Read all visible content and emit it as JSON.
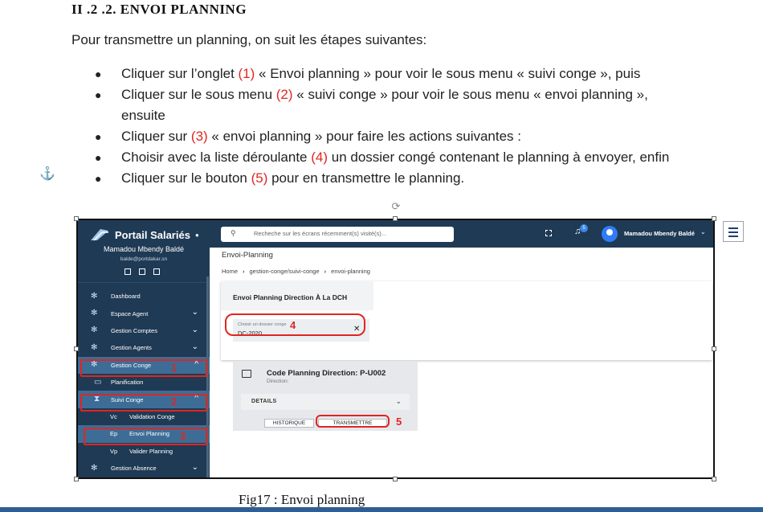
{
  "heading": "II .2 .2.  ENVOI PLANNING",
  "intro": "Pour transmettre un planning, on suit les étapes suivantes:",
  "steps": [
    {
      "pre": "Cliquer sur l’onglet ",
      "num": "(1)",
      "post": " « Envoi planning » pour voir le sous menu « suivi conge », puis"
    },
    {
      "pre": "Cliquer sur le sous menu ",
      "num": "(2)",
      "post": " « suivi conge » pour voir le sous menu « envoi planning », ensuite"
    },
    {
      "pre": "Cliquer sur ",
      "num": "(3)",
      "post": " « envoi planning » pour faire les actions suivantes :"
    },
    {
      "pre": "Choisir avec la liste déroulante ",
      "num": "(4)",
      "post": " un dossier congé contenant le planning à envoyer, enfin"
    },
    {
      "pre": "Cliquer sur le bouton ",
      "num": "(5)",
      "post": " pour en transmettre le planning."
    }
  ],
  "icons": {
    "anchor": "anchor-icon",
    "rotate": "rotate-handle-icon",
    "layout": "layout-options-icon"
  },
  "app": {
    "brand": "Portail Salariés",
    "user_name": "Mamadou Mbendy Baldé",
    "user_email": "balde@portdakar.sn",
    "menu": [
      {
        "label": "Dashboard",
        "chev": ""
      },
      {
        "label": "Espace Agent",
        "chev": "⌄"
      },
      {
        "label": "Gestion Comptes",
        "chev": "⌄"
      },
      {
        "label": "Gestion Agents",
        "chev": "⌄"
      },
      {
        "label": "Gestion Conge",
        "chev": "^"
      },
      {
        "label": "Planification",
        "chev": ""
      },
      {
        "label": "Suivi Conge",
        "chev": "^"
      },
      {
        "abbr": "Vc",
        "label": "Validation Conge"
      },
      {
        "abbr": "Ep",
        "label": "Envoi Planning"
      },
      {
        "abbr": "Vp",
        "label": "Valider Planning"
      },
      {
        "label": "Gestion Absence",
        "chev": "⌄"
      }
    ],
    "search_placeholder": "Recheche sur les écrans récemment(s) visité(s)...",
    "notification_count": "5",
    "top_user": "Mamadou Mbendy Baldé",
    "page_title": "Envoi-Planning",
    "breadcrumb": [
      "Home",
      "gestion-conge/suivi-conge",
      "envoi-planning"
    ],
    "card_title": "Envoi Planning Direction À La DCH",
    "field_label": "Choisir un dossier conge",
    "field_value": "DC-2020",
    "plan_code": "Code Planning Direction: P-U002",
    "plan_sub": "Direction:",
    "details_label": "DETAILS",
    "btn_historique": "HISTORIQUE",
    "btn_transmettre": "TRANSMETTRE",
    "markers": [
      "1",
      "2",
      "3",
      "4",
      "5"
    ],
    "annotation_color": "#e0261f",
    "sidebar_color": "#1f3a55"
  },
  "caption": "Fig17 : Envoi planning"
}
